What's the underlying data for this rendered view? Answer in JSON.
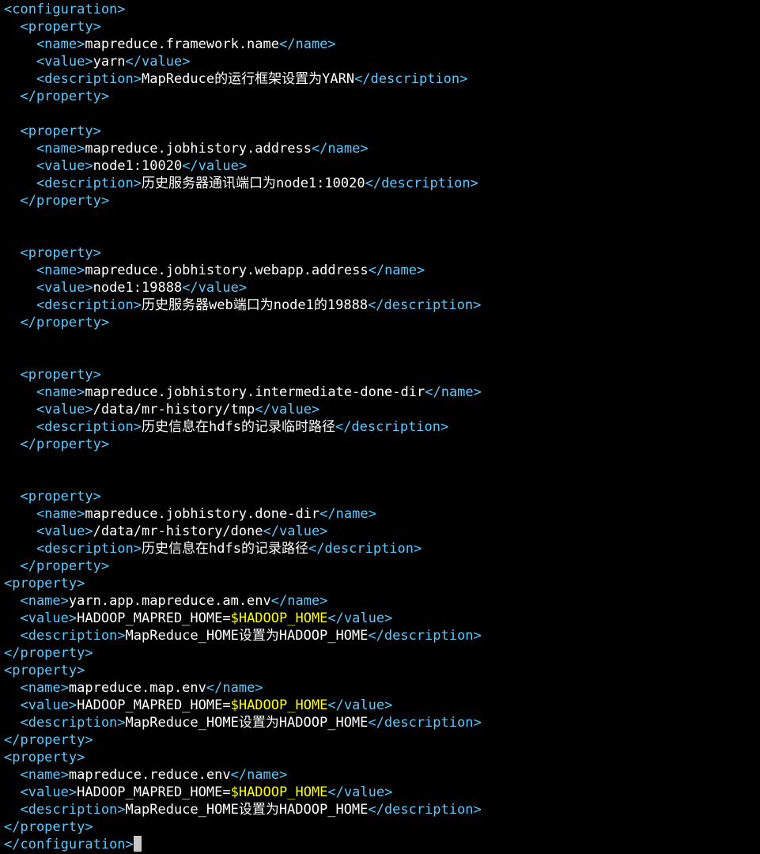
{
  "editor": {
    "lines": [
      [
        {
          "t": "<configuration>",
          "c": "tag"
        }
      ],
      [
        {
          "t": "  <property>",
          "c": "tag"
        }
      ],
      [
        {
          "t": "    <name>",
          "c": "tag"
        },
        {
          "t": "mapreduce.framework.name",
          "c": "txt"
        },
        {
          "t": "</name>",
          "c": "tag"
        }
      ],
      [
        {
          "t": "    <value>",
          "c": "tag"
        },
        {
          "t": "yarn",
          "c": "txt"
        },
        {
          "t": "</value>",
          "c": "tag"
        }
      ],
      [
        {
          "t": "    <description>",
          "c": "tag"
        },
        {
          "t": "MapReduce的运行框架设置为YARN",
          "c": "txt"
        },
        {
          "t": "</description>",
          "c": "tag"
        }
      ],
      [
        {
          "t": "  </property>",
          "c": "tag"
        }
      ],
      [],
      [
        {
          "t": "  <property>",
          "c": "tag"
        }
      ],
      [
        {
          "t": "    <name>",
          "c": "tag"
        },
        {
          "t": "mapreduce.jobhistory.address",
          "c": "txt"
        },
        {
          "t": "</name>",
          "c": "tag"
        }
      ],
      [
        {
          "t": "    <value>",
          "c": "tag"
        },
        {
          "t": "node1:10020",
          "c": "txt"
        },
        {
          "t": "</value>",
          "c": "tag"
        }
      ],
      [
        {
          "t": "    <description>",
          "c": "tag"
        },
        {
          "t": "历史服务器通讯端口为node1:10020",
          "c": "txt"
        },
        {
          "t": "</description>",
          "c": "tag"
        }
      ],
      [
        {
          "t": "  </property>",
          "c": "tag"
        }
      ],
      [],
      [],
      [
        {
          "t": "  <property>",
          "c": "tag"
        }
      ],
      [
        {
          "t": "    <name>",
          "c": "tag"
        },
        {
          "t": "mapreduce.jobhistory.webapp.address",
          "c": "txt"
        },
        {
          "t": "</name>",
          "c": "tag"
        }
      ],
      [
        {
          "t": "    <value>",
          "c": "tag"
        },
        {
          "t": "node1:19888",
          "c": "txt"
        },
        {
          "t": "</value>",
          "c": "tag"
        }
      ],
      [
        {
          "t": "    <description>",
          "c": "tag"
        },
        {
          "t": "历史服务器web端口为node1的19888",
          "c": "txt"
        },
        {
          "t": "</description>",
          "c": "tag"
        }
      ],
      [
        {
          "t": "  </property>",
          "c": "tag"
        }
      ],
      [],
      [],
      [
        {
          "t": "  <property>",
          "c": "tag"
        }
      ],
      [
        {
          "t": "    <name>",
          "c": "tag"
        },
        {
          "t": "mapreduce.jobhistory.intermediate-done-dir",
          "c": "txt"
        },
        {
          "t": "</name>",
          "c": "tag"
        }
      ],
      [
        {
          "t": "    <value>",
          "c": "tag"
        },
        {
          "t": "/data/mr-history/tmp",
          "c": "txt"
        },
        {
          "t": "</value>",
          "c": "tag"
        }
      ],
      [
        {
          "t": "    <description>",
          "c": "tag"
        },
        {
          "t": "历史信息在hdfs的记录临时路径",
          "c": "txt"
        },
        {
          "t": "</description>",
          "c": "tag"
        }
      ],
      [
        {
          "t": "  </property>",
          "c": "tag"
        }
      ],
      [],
      [],
      [
        {
          "t": "  <property>",
          "c": "tag"
        }
      ],
      [
        {
          "t": "    <name>",
          "c": "tag"
        },
        {
          "t": "mapreduce.jobhistory.done-dir",
          "c": "txt"
        },
        {
          "t": "</name>",
          "c": "tag"
        }
      ],
      [
        {
          "t": "    <value>",
          "c": "tag"
        },
        {
          "t": "/data/mr-history/done",
          "c": "txt"
        },
        {
          "t": "</value>",
          "c": "tag"
        }
      ],
      [
        {
          "t": "    <description>",
          "c": "tag"
        },
        {
          "t": "历史信息在hdfs的记录路径",
          "c": "txt"
        },
        {
          "t": "</description>",
          "c": "tag"
        }
      ],
      [
        {
          "t": "  </property>",
          "c": "tag"
        }
      ],
      [
        {
          "t": "<property>",
          "c": "tag"
        }
      ],
      [
        {
          "t": "  <name>",
          "c": "tag"
        },
        {
          "t": "yarn.app.mapreduce.am.env",
          "c": "txt"
        },
        {
          "t": "</name>",
          "c": "tag"
        }
      ],
      [
        {
          "t": "  <value>",
          "c": "tag"
        },
        {
          "t": "HADOOP_MAPRED_HOME=",
          "c": "txt"
        },
        {
          "t": "$HADOOP_HOME",
          "c": "var"
        },
        {
          "t": "</value>",
          "c": "tag"
        }
      ],
      [
        {
          "t": "  <description>",
          "c": "tag"
        },
        {
          "t": "MapReduce_HOME设置为HADOOP_HOME",
          "c": "txt"
        },
        {
          "t": "</description>",
          "c": "tag"
        }
      ],
      [
        {
          "t": "</property>",
          "c": "tag"
        }
      ],
      [
        {
          "t": "<property>",
          "c": "tag"
        }
      ],
      [
        {
          "t": "  <name>",
          "c": "tag"
        },
        {
          "t": "mapreduce.map.env",
          "c": "txt"
        },
        {
          "t": "</name>",
          "c": "tag"
        }
      ],
      [
        {
          "t": "  <value>",
          "c": "tag"
        },
        {
          "t": "HADOOP_MAPRED_HOME=",
          "c": "txt"
        },
        {
          "t": "$HADOOP_HOME",
          "c": "var"
        },
        {
          "t": "</value>",
          "c": "tag"
        }
      ],
      [
        {
          "t": "  <description>",
          "c": "tag"
        },
        {
          "t": "MapReduce_HOME设置为HADOOP_HOME",
          "c": "txt"
        },
        {
          "t": "</description>",
          "c": "tag"
        }
      ],
      [
        {
          "t": "</property>",
          "c": "tag"
        }
      ],
      [
        {
          "t": "<property>",
          "c": "tag"
        }
      ],
      [
        {
          "t": "  <name>",
          "c": "tag"
        },
        {
          "t": "mapreduce.reduce.env",
          "c": "txt"
        },
        {
          "t": "</name>",
          "c": "tag"
        }
      ],
      [
        {
          "t": "  <value>",
          "c": "tag"
        },
        {
          "t": "HADOOP_MAPRED_HOME=",
          "c": "txt"
        },
        {
          "t": "$HADOOP_HOME",
          "c": "var"
        },
        {
          "t": "</value>",
          "c": "tag"
        }
      ],
      [
        {
          "t": "  <description>",
          "c": "tag"
        },
        {
          "t": "MapReduce_HOME设置为HADOOP_HOME",
          "c": "txt"
        },
        {
          "t": "</description>",
          "c": "tag"
        }
      ],
      [
        {
          "t": "</property>",
          "c": "tag"
        }
      ],
      [
        {
          "t": "</configuration>",
          "c": "tag"
        }
      ]
    ],
    "cursor_line": 48
  },
  "colors": {
    "background": "#000000",
    "tag": "#5cc8ff",
    "text": "#ffffff",
    "variable": "#ffff00",
    "cursor": "#c7c7c7"
  }
}
